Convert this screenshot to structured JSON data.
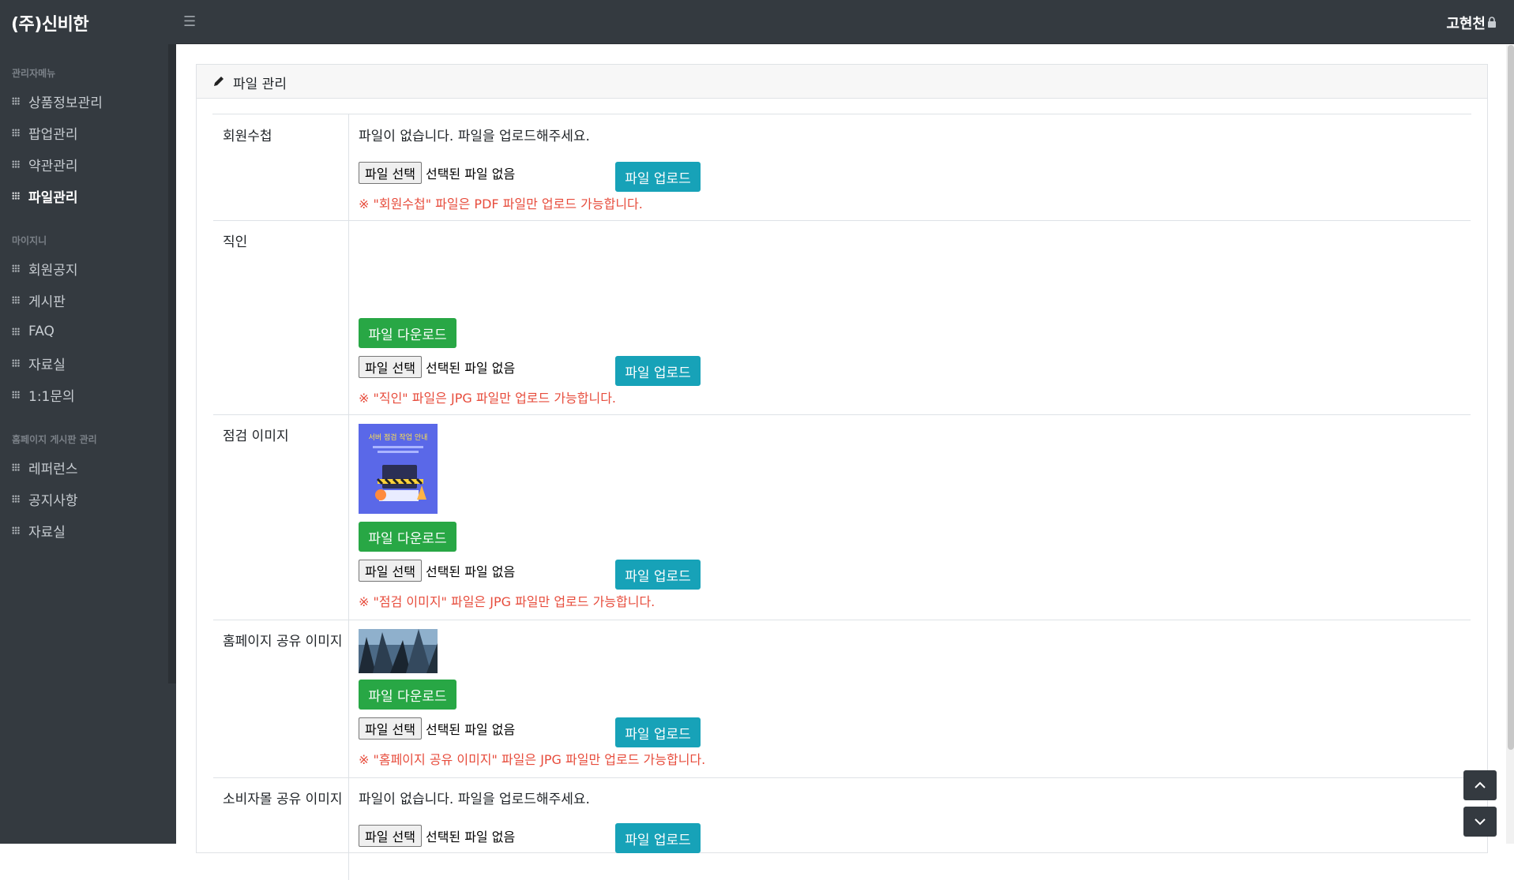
{
  "app": {
    "brand": "(주)신비한",
    "user": "고현천"
  },
  "sidebar": {
    "sections": [
      {
        "title": "관리자메뉴",
        "items": [
          "상품정보관리",
          "팝업관리",
          "약관관리",
          "파일관리"
        ]
      },
      {
        "title": "마이지니",
        "items": [
          "회원공지",
          "게시판",
          "FAQ",
          "자료실",
          "1:1문의"
        ]
      },
      {
        "title": "홈페이지 게시판 관리",
        "items": [
          "레퍼런스",
          "공지사항",
          "자료실"
        ]
      }
    ],
    "active": "파일관리"
  },
  "card": {
    "title": "파일 관리"
  },
  "common": {
    "choose_label": "파일 선택",
    "no_file": "선택된 파일 없음",
    "upload_label": "파일 업로드",
    "download_label": "파일 다운로드",
    "empty_msg": "파일이 없습니다. 파일을 업로드해주세요."
  },
  "rows": [
    {
      "label": "회원수첩",
      "note": "※ \"회원수첩\" 파일은 PDF 파일만 업로드 가능합니다."
    },
    {
      "label": "직인",
      "note": "※ \"직인\" 파일은 JPG 파일만 업로드 가능합니다."
    },
    {
      "label": "점검 이미지",
      "note": "※ \"점검 이미지\" 파일은 JPG 파일만 업로드 가능합니다.",
      "thumb_text": "서버 점검 작업 안내"
    },
    {
      "label": "홈페이지 공유 이미지",
      "note": "※ \"홈페이지 공유 이미지\" 파일은 JPG 파일만 업로드 가능합니다."
    },
    {
      "label": "소비자몰 공유 이미지"
    }
  ],
  "colors": {
    "sidebar_bg": "#343a40",
    "upload": "#17a2b8",
    "download": "#28a745",
    "note": "#e74c3c"
  }
}
